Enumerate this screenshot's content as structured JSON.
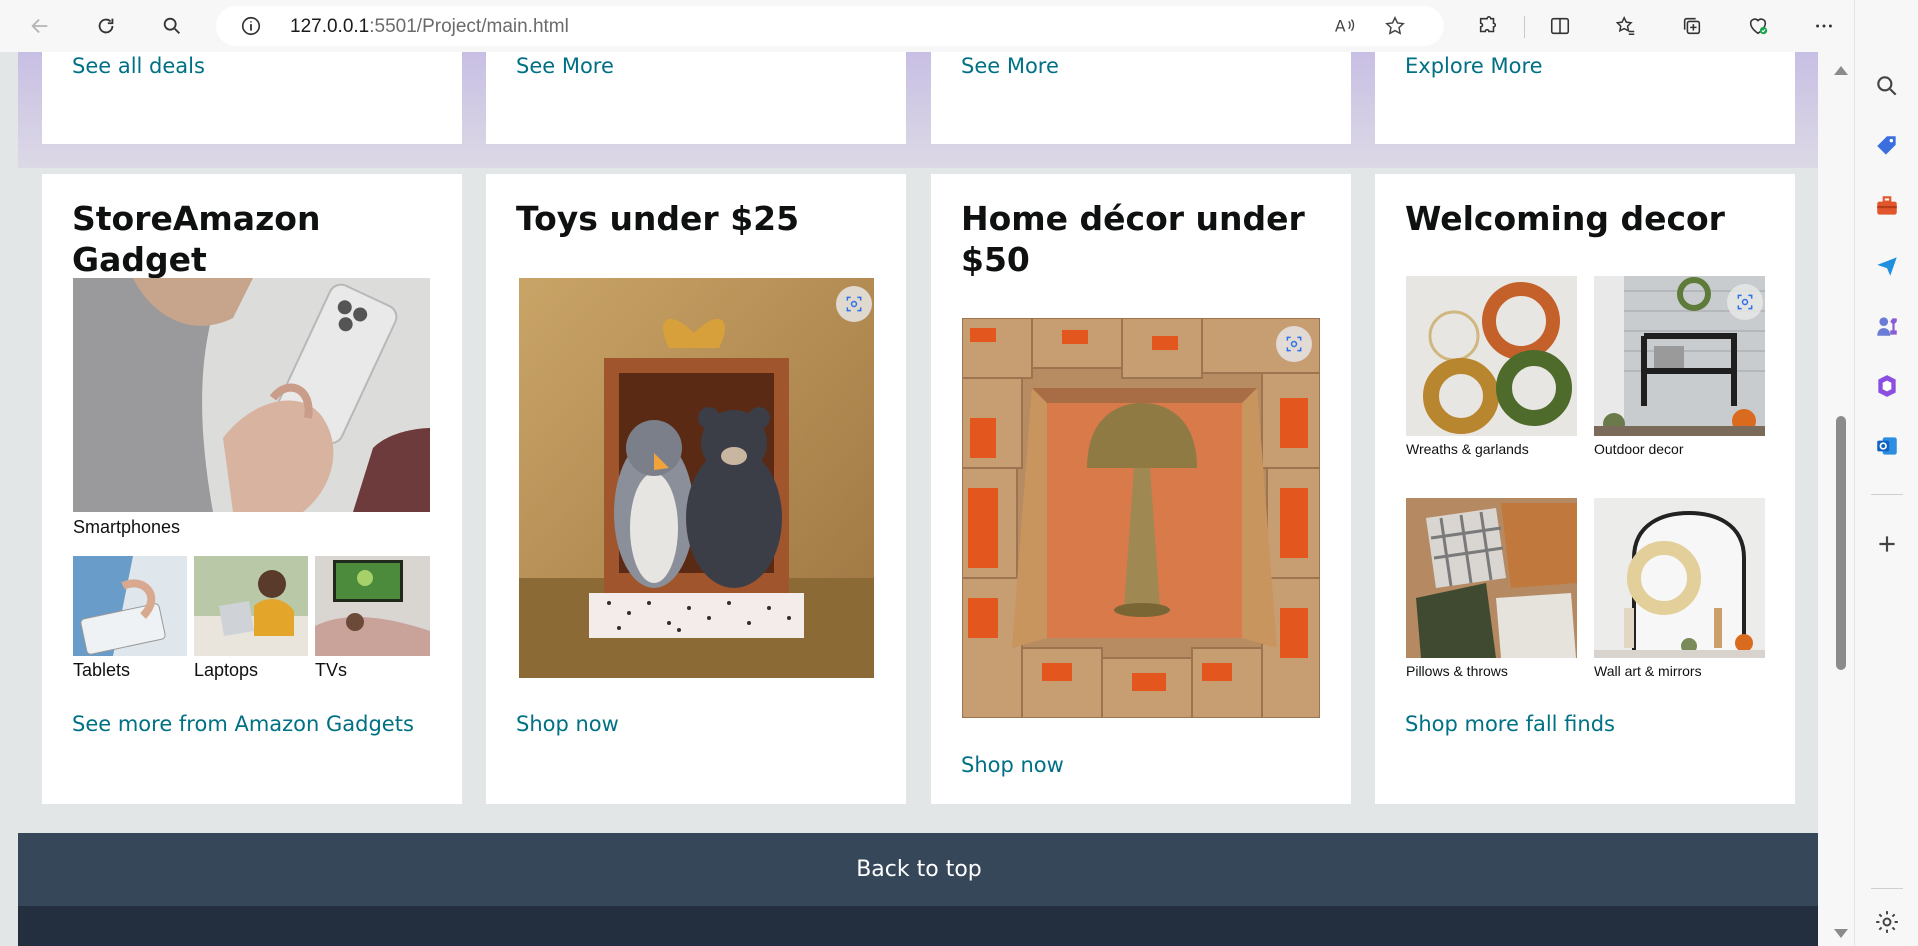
{
  "browser": {
    "url_host": "127.0.0.1",
    "url_rest": ":5501/Project/main.html"
  },
  "top_row": {
    "links": [
      "See all deals",
      "See More",
      "See More",
      "Explore More"
    ]
  },
  "cards": {
    "gadget": {
      "title": "StoreAmazon Gadget",
      "main_caption": "Smartphones",
      "small_captions": [
        "Tablets",
        "Laptops",
        "TVs"
      ],
      "link": "See more from Amazon Gadgets"
    },
    "toys": {
      "title": "Toys under $25",
      "link": "Shop now"
    },
    "homedecor": {
      "title": "Home décor under $50",
      "link": "Shop now"
    },
    "welcoming": {
      "title": "Welcoming decor",
      "captions": [
        "Wreaths & garlands",
        "Outdoor decor",
        "Pillows & throws",
        "Wall art & mirrors"
      ],
      "link": "Shop more fall finds"
    }
  },
  "footer": {
    "back_to_top": "Back to top"
  },
  "colors": {
    "link": "#007185",
    "back_to_top_bg": "#37475a",
    "footer_bg": "#232f3e",
    "page_bg": "#e3e6e6"
  }
}
